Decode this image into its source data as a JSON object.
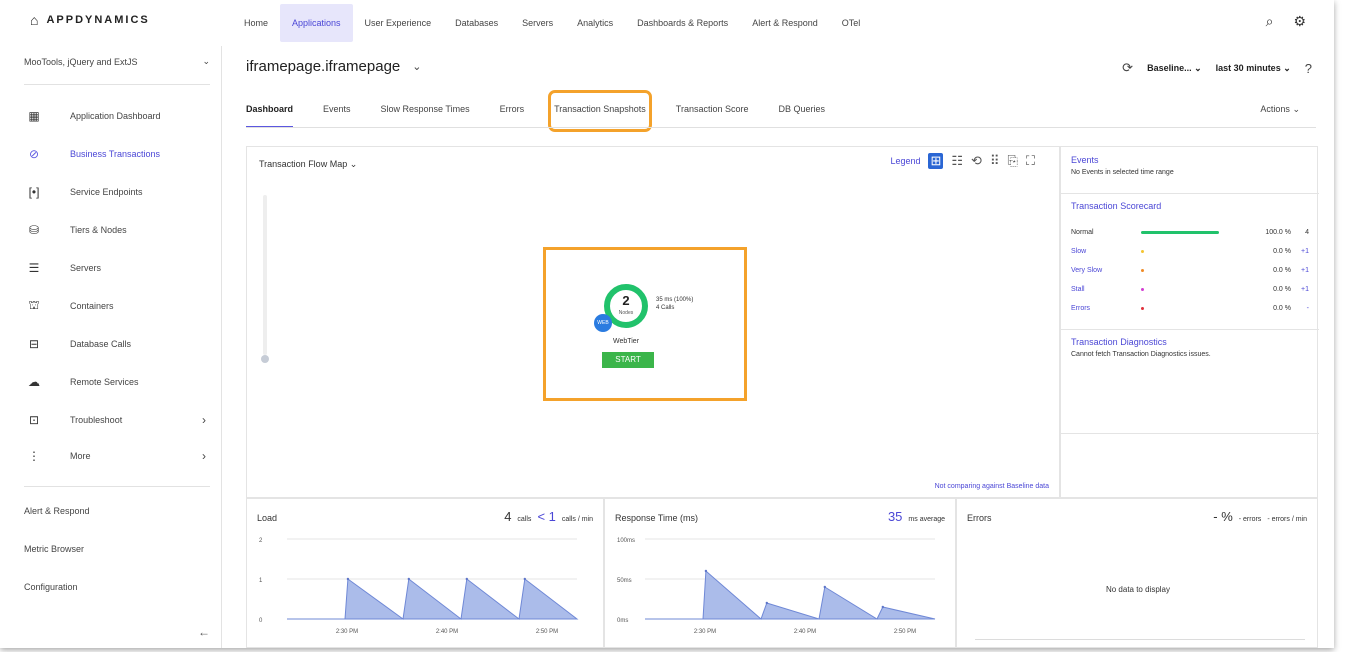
{
  "brand": {
    "name": "APPDYNAMICS"
  },
  "topnav": {
    "items": [
      {
        "label": "Home"
      },
      {
        "label": "Applications",
        "active": true
      },
      {
        "label": "User Experience"
      },
      {
        "label": "Databases"
      },
      {
        "label": "Servers"
      },
      {
        "label": "Analytics"
      },
      {
        "label": "Dashboards & Reports"
      },
      {
        "label": "Alert & Respond"
      },
      {
        "label": "OTel"
      }
    ]
  },
  "sidebar": {
    "app": "MooTools, jQuery and ExtJS",
    "items": [
      {
        "label": "Application Dashboard",
        "icon": "dashboard-icon"
      },
      {
        "label": "Business Transactions",
        "icon": "business-transactions-icon",
        "active": true
      },
      {
        "label": "Service Endpoints",
        "icon": "service-endpoints-icon"
      },
      {
        "label": "Tiers & Nodes",
        "icon": "tiers-nodes-icon"
      },
      {
        "label": "Servers",
        "icon": "servers-icon"
      },
      {
        "label": "Containers",
        "icon": "containers-icon"
      },
      {
        "label": "Database Calls",
        "icon": "database-icon"
      },
      {
        "label": "Remote Services",
        "icon": "remote-services-icon"
      },
      {
        "label": "Troubleshoot",
        "icon": "troubleshoot-icon"
      },
      {
        "label": "More",
        "icon": "more-icon"
      }
    ],
    "links": [
      "Alert & Respond",
      "Metric Browser",
      "Configuration"
    ]
  },
  "page": {
    "title": "iframepage.iframepage",
    "baseline": "Baseline...",
    "timerange": "last 30 minutes",
    "actions": "Actions"
  },
  "tabs": [
    "Dashboard",
    "Events",
    "Slow Response Times",
    "Errors",
    "Transaction Snapshots",
    "Transaction Score",
    "DB Queries"
  ],
  "flowmap": {
    "title": "Transaction Flow Map",
    "legend": "Legend",
    "node_count": "2",
    "node_label": "Nodes",
    "badge": "WEB",
    "stat1": "35 ms (100%)",
    "stat2": "4 Calls",
    "tier": "WebTier",
    "start": "START",
    "baseline_note": "Not comparing against Baseline data"
  },
  "rightpanel": {
    "events_title": "Events",
    "events_text": "No Events in selected time range",
    "scorecard_title": "Transaction Scorecard",
    "scorecard": [
      {
        "label": "Normal",
        "pct": "100.0 %",
        "delta": "4",
        "color": "#21c26b",
        "level": 1.0
      },
      {
        "label": "Slow",
        "pct": "0.0 %",
        "delta": "+1",
        "color": "#f4c430",
        "level": 0.0
      },
      {
        "label": "Very Slow",
        "pct": "0.0 %",
        "delta": "+1",
        "color": "#f08a24",
        "level": 0.0
      },
      {
        "label": "Stall",
        "pct": "0.0 %",
        "delta": "+1",
        "color": "#d23cd2",
        "level": 0.0
      },
      {
        "label": "Errors",
        "pct": "0.0 %",
        "delta": "-",
        "color": "#e0303a",
        "level": 0.0
      }
    ],
    "diag_title": "Transaction Diagnostics",
    "diag_text": "Cannot fetch Transaction Diagnostics issues."
  },
  "load": {
    "title": "Load",
    "calls": "4",
    "calls_label": "calls",
    "rate": "< 1",
    "rate_label": "calls / min"
  },
  "response": {
    "title": "Response Time (ms)",
    "avg": "35",
    "avg_label": "ms average"
  },
  "errors": {
    "title": "Errors",
    "pct": "- %",
    "errors_label": "errors",
    "rate_label": "errors / min",
    "nodata": "No data to display"
  },
  "chart_data": [
    {
      "type": "area",
      "title": "Load",
      "y_ticks": [
        "2",
        "1",
        "0"
      ],
      "x_ticks": [
        "2:30 PM",
        "2:40 PM",
        "2:50 PM"
      ],
      "ylim": [
        0,
        2
      ],
      "x": [
        0,
        4,
        4.2,
        8,
        8.4,
        12,
        12.4,
        16,
        16.4,
        20
      ],
      "values": [
        0,
        0,
        1,
        0,
        1,
        0,
        1,
        0,
        1,
        0
      ],
      "color": "#8fa5e3"
    },
    {
      "type": "area",
      "title": "Response Time (ms)",
      "y_ticks": [
        "100ms",
        "50ms",
        "0ms"
      ],
      "x_ticks": [
        "2:30 PM",
        "2:40 PM",
        "2:50 PM"
      ],
      "ylim": [
        0,
        100
      ],
      "x": [
        0,
        4,
        4.2,
        8,
        8.4,
        12,
        12.4,
        16,
        16.4,
        20
      ],
      "values": [
        0,
        0,
        60,
        0,
        20,
        0,
        40,
        0,
        15,
        0
      ],
      "color": "#8fa5e3"
    }
  ]
}
